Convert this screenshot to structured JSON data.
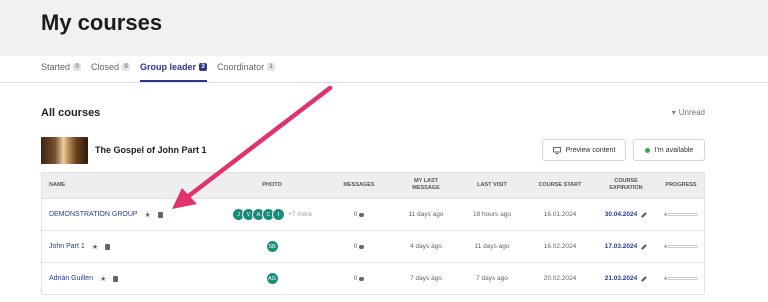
{
  "page": {
    "title": "My courses"
  },
  "tabs": [
    {
      "label": "Started",
      "count": "0",
      "active": false
    },
    {
      "label": "Closed",
      "count": "9",
      "active": false
    },
    {
      "label": "Group leader",
      "count": "3",
      "active": true
    },
    {
      "label": "Coordinator",
      "count": "1",
      "active": false
    }
  ],
  "section": {
    "title": "All courses",
    "filter_label": "Unread"
  },
  "course": {
    "name": "The Gospel of John Part 1"
  },
  "buttons": {
    "preview": "Preview content",
    "available": "I'm available"
  },
  "table": {
    "headers": {
      "name": "NAME",
      "photo": "PHOTO",
      "messages": "MESSAGES",
      "my_last_message_1": "MY LAST",
      "my_last_message_2": "MESSAGE",
      "last_visit": "LAST VISIT",
      "course_start": "COURSE START",
      "course_expiration_1": "COURSE",
      "course_expiration_2": "EXPIRATION",
      "progress": "PROGRESS"
    },
    "rows": [
      {
        "name": "DEMONSTRATION GROUP",
        "avatars": [
          "J",
          "V",
          "A",
          "C",
          "I"
        ],
        "more": "+7 more",
        "messages": "0",
        "my_last_message": "11 days ago",
        "last_visit": "18 hours ago",
        "course_start": "16.01.2024",
        "course_expiration": "30.04.2024",
        "progress": 0.03
      },
      {
        "name": "John Part 1",
        "avatars": [
          "SB"
        ],
        "more": "",
        "messages": "0",
        "my_last_message": "4 days ago",
        "last_visit": "11 days ago",
        "course_start": "16.02.2024",
        "course_expiration": "17.03.2024",
        "progress": 0.03
      },
      {
        "name": "Adrián Guillen",
        "avatars": [
          "AG"
        ],
        "more": "",
        "messages": "0",
        "my_last_message": "7 days ago",
        "last_visit": "7 days ago",
        "course_start": "20.02.2024",
        "course_expiration": "21.03.2024",
        "progress": 0.03
      }
    ]
  },
  "colors": {
    "accent": "#2b3a8f",
    "avatar": "#1b8b7a",
    "arrow": "#e0336b",
    "available_dot": "#2faa4a"
  },
  "icons": {
    "filter": "caret-down-icon",
    "preview": "monitor-icon",
    "star": "star-icon",
    "note": "note-icon",
    "message": "chat-bubble-icon",
    "edit": "pencil-icon"
  }
}
